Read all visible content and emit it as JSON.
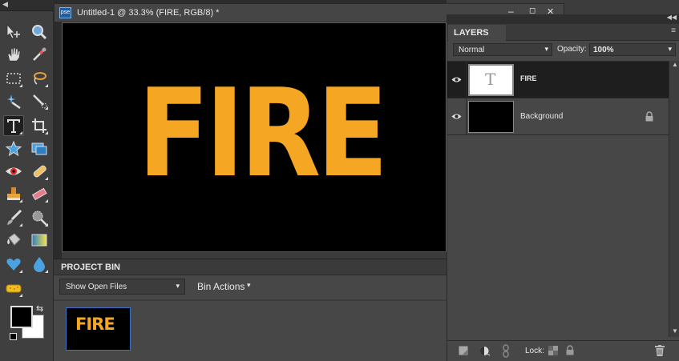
{
  "document": {
    "title": "Untitled-1 @ 33.3% (FIRE, RGB/8) *",
    "app_badge": "pse",
    "canvas_text": "FIRE",
    "text_color": "#f5a623",
    "canvas_bg": "#000000"
  },
  "window_controls": [
    "–",
    "◻",
    "✕"
  ],
  "project_bin": {
    "title": "PROJECT BIN",
    "dropdown_value": "Show Open Files",
    "actions_label": "Bin Actions",
    "thumbnail_text": "FIRE"
  },
  "layers_panel": {
    "tab_label": "LAYERS",
    "blend_mode": "Normal",
    "opacity_label": "Opacity:",
    "opacity_value": "100%",
    "layers": [
      {
        "name": "FIRE",
        "type": "text",
        "thumb_glyph": "T",
        "selected": true
      },
      {
        "name": "Background",
        "type": "background",
        "locked": true,
        "selected": false
      }
    ],
    "lock_label": "Lock:"
  },
  "toolbox": {
    "tools": [
      "move-icon",
      "zoom-icon",
      "hand-icon",
      "eyedropper-icon",
      "marquee-icon",
      "lasso-icon",
      "magic-wand-icon",
      "selection-brush-icon",
      "type-icon",
      "crop-icon",
      "cookie-cutter-icon",
      "recompose-icon",
      "red-eye-icon",
      "spot-healing-icon",
      "clone-stamp-icon",
      "eraser-icon",
      "brush-icon",
      "smart-brush-icon",
      "paint-bucket-icon",
      "gradient-icon",
      "custom-shape-icon",
      "blur-icon",
      "sponge-icon"
    ],
    "foreground_color": "#000000",
    "background_color": "#ffffff"
  }
}
